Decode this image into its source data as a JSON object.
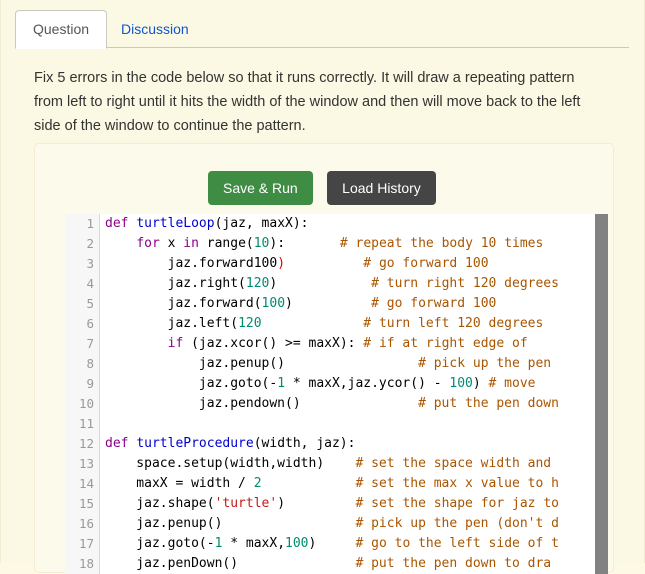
{
  "tabs": [
    {
      "label": "Question",
      "active": true
    },
    {
      "label": "Discussion",
      "active": false
    }
  ],
  "prompt": "Fix 5 errors in the code below so that it runs correctly. It will draw a repeating pattern from left to right until it hits the width of the window and then will move back to the left side of the window to continue the pattern.",
  "buttons": {
    "save_run": "Save & Run",
    "load_history": "Load History"
  },
  "colors": {
    "page_background": "#fbf8e3",
    "card_background": "#fcfaea",
    "save_run": "#3f8c44",
    "load_history": "#454545",
    "tab_link": "#1155cc",
    "keyword": "#8b008b",
    "function": "#0000cf",
    "number": "#008b6f",
    "string": "#c41a16",
    "comment": "#aa5500",
    "error": "#e00000",
    "gutter": "#f7f7f7",
    "scrollbar_thumb": "#828282"
  },
  "editor": {
    "line_numbers": [
      1,
      2,
      3,
      4,
      5,
      6,
      7,
      8,
      9,
      10,
      11,
      12,
      13,
      14,
      15,
      16,
      17,
      18
    ],
    "lines": [
      {
        "n": 1,
        "code": "def turtleLoop(jaz, maxX):",
        "comment": ""
      },
      {
        "n": 2,
        "code": "    for x in range(10):",
        "comment": "# repeat the body 10 times"
      },
      {
        "n": 3,
        "code": "        jaz.forward100)",
        "comment": "# go forward 100"
      },
      {
        "n": 4,
        "code": "        jaz.right(120)",
        "comment": "# turn right 120 degrees"
      },
      {
        "n": 5,
        "code": "        jaz.forward(100)",
        "comment": "# go forward 100"
      },
      {
        "n": 6,
        "code": "        jaz.left(120",
        "comment": "# turn left 120 degrees"
      },
      {
        "n": 7,
        "code": "        if (jaz.xcor() >= maxX):",
        "comment": "# if at right edge of"
      },
      {
        "n": 8,
        "code": "            jaz.penup()",
        "comment": "# pick up the pen"
      },
      {
        "n": 9,
        "code": "            jaz.goto(-1 * maxX,jaz.ycor() - 100)",
        "comment": "# move"
      },
      {
        "n": 10,
        "code": "            jaz.pendown()",
        "comment": "# put the pen down"
      },
      {
        "n": 11,
        "code": "",
        "comment": ""
      },
      {
        "n": 12,
        "code": "def turtleProcedure(width, jaz):",
        "comment": ""
      },
      {
        "n": 13,
        "code": "    space.setup(width,width)",
        "comment": "# set the space width and"
      },
      {
        "n": 14,
        "code": "    maxX = width / 2",
        "comment": "# set the max x value to h"
      },
      {
        "n": 15,
        "code": "    jaz.shape('turtle')",
        "comment": "# set the shape for jaz to"
      },
      {
        "n": 16,
        "code": "    jaz.penup()",
        "comment": "# pick up the pen (don't d"
      },
      {
        "n": 17,
        "code": "    jaz.goto(-1 * maxX,100)",
        "comment": "# go to the left side of t"
      },
      {
        "n": 18,
        "code": "    jaz.penDown()",
        "comment": "# put the pen down to dra"
      }
    ]
  }
}
